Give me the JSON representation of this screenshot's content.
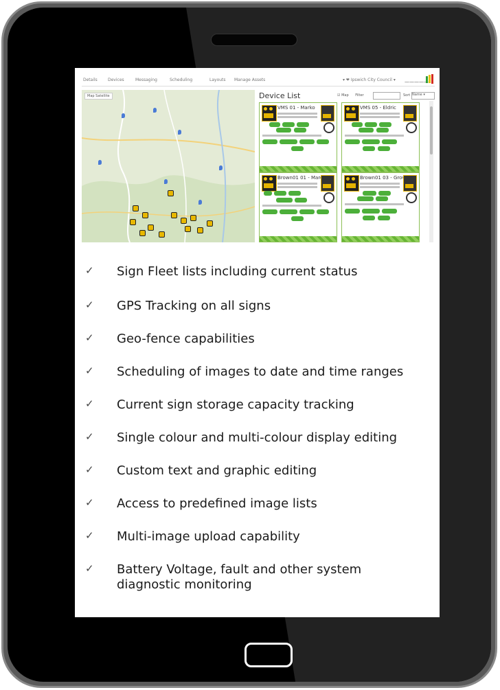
{
  "app": {
    "nav_tabs": [
      "Details",
      "Devices",
      "Messaging",
      "Scheduling",
      "Layouts",
      "Manage Assets"
    ],
    "account": "▾ ❤ Ipswich City Council ▾",
    "map_tabs": "Map  Satellite",
    "device_list_title": "Device List",
    "map_toggle": "☑ Map",
    "filter_label": "Filter",
    "sort_label": "Sort",
    "sort_value": "Name ▾",
    "cards": [
      {
        "title": "VMS 01 - Marko"
      },
      {
        "title": "VMS 05 - Eldric"
      },
      {
        "title": "Brown01 01 - Marc"
      },
      {
        "title": "Brown01 03 - Grove"
      }
    ]
  },
  "features": [
    "Sign Fleet lists including current status",
    "GPS Tracking on all signs",
    "Geo-fence capabilities",
    "Scheduling of images to date and time ranges",
    "Current sign storage capacity tracking",
    "Single colour and multi-colour display editing",
    "Custom text and graphic editing",
    "Access to predefined image lists",
    "Multi-image upload capability",
    "Battery Voltage, fault and other system diagnostic monitoring"
  ],
  "check_glyph": "✓",
  "colors": {
    "frame": "#5a5a5a",
    "bezel": "#000000",
    "accent_green": "#4caf3a",
    "sign_yellow": "#e8b800"
  }
}
